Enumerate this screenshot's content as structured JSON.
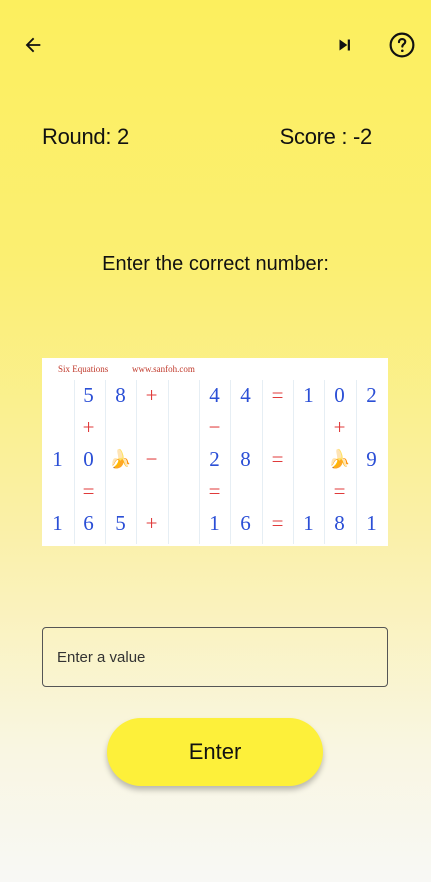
{
  "header": {
    "back_icon": "arrow-left-icon",
    "skip_icon": "skip-next-icon",
    "help_icon": "help-circle-icon"
  },
  "status": {
    "round_label": "Round: 2",
    "score_label": "Score : -2"
  },
  "prompt": "Enter the correct number:",
  "puzzle": {
    "title": "Six Equations",
    "site": "www.sanfoh.com",
    "rows": [
      [
        "",
        "5",
        "8",
        "+",
        "",
        "4",
        "4",
        "=",
        "1",
        "0",
        "2"
      ],
      [
        "",
        "+",
        "",
        "",
        "",
        "−",
        "",
        "",
        "",
        "+",
        ""
      ],
      [
        "1",
        "0",
        "🍌",
        "−",
        "",
        "2",
        "8",
        "=",
        "",
        "🍌",
        "9"
      ],
      [
        "",
        "=",
        "",
        "",
        "",
        "=",
        "",
        "",
        "",
        "=",
        ""
      ],
      [
        "1",
        "6",
        "5",
        "+",
        "",
        "1",
        "6",
        "=",
        "1",
        "8",
        "1"
      ]
    ]
  },
  "input": {
    "placeholder": "Enter a value",
    "value": ""
  },
  "submit_label": "Enter",
  "colors": {
    "number": "#2b4fd6",
    "operator": "#e03a3a",
    "button": "#fdf03a"
  }
}
